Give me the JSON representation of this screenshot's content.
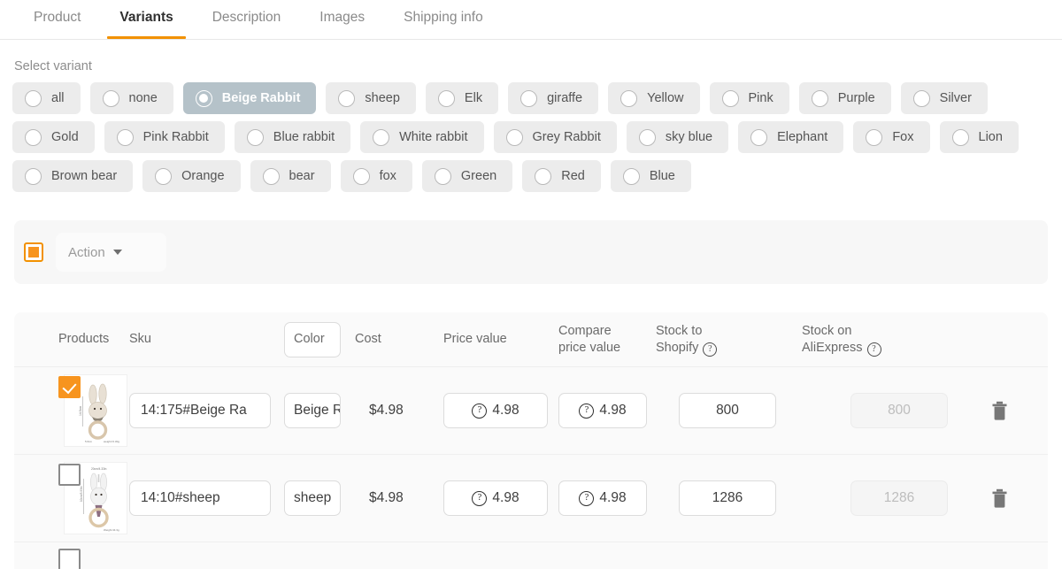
{
  "tabs": [
    {
      "label": "Product",
      "active": false
    },
    {
      "label": "Variants",
      "active": true
    },
    {
      "label": "Description",
      "active": false
    },
    {
      "label": "Images",
      "active": false
    },
    {
      "label": "Shipping info",
      "active": false
    }
  ],
  "variants": {
    "section_label": "Select variant",
    "selected": "Beige Rabbit",
    "chips": [
      {
        "label": "all",
        "selected": false
      },
      {
        "label": "none",
        "selected": false
      },
      {
        "label": "Beige Rabbit",
        "selected": true
      },
      {
        "label": "sheep",
        "selected": false
      },
      {
        "label": "Elk",
        "selected": false
      },
      {
        "label": "giraffe",
        "selected": false
      },
      {
        "label": "Yellow",
        "selected": false
      },
      {
        "label": "Pink",
        "selected": false
      },
      {
        "label": "Purple",
        "selected": false
      },
      {
        "label": "Silver",
        "selected": false
      },
      {
        "label": "Gold",
        "selected": false
      },
      {
        "label": "Pink Rabbit",
        "selected": false
      },
      {
        "label": "Blue rabbit",
        "selected": false
      },
      {
        "label": "White rabbit",
        "selected": false
      },
      {
        "label": "Grey Rabbit",
        "selected": false
      },
      {
        "label": "sky blue",
        "selected": false
      },
      {
        "label": "Elephant",
        "selected": false
      },
      {
        "label": "Fox",
        "selected": false
      },
      {
        "label": "Lion",
        "selected": false
      },
      {
        "label": "Brown bear",
        "selected": false
      },
      {
        "label": "Orange",
        "selected": false
      },
      {
        "label": "bear",
        "selected": false
      },
      {
        "label": "fox",
        "selected": false
      },
      {
        "label": "Green",
        "selected": false
      },
      {
        "label": "Red",
        "selected": false
      },
      {
        "label": "Blue",
        "selected": false
      }
    ]
  },
  "action_bar": {
    "checkbox_state": "indeterminate",
    "select_label": "Action",
    "caret_icon": "chevron-down-icon"
  },
  "table": {
    "headers": {
      "products": "Products",
      "sku": "Sku",
      "color": "Color",
      "cost": "Cost",
      "price_value": "Price value",
      "compare_line1": "Compare",
      "compare_line2": "price value",
      "stock_shopify_line1": "Stock to",
      "stock_shopify_line2": "Shopify",
      "stock_ali_line1": "Stock on",
      "stock_ali_line2": "AliExpress",
      "help_icon": "help-circle-icon"
    },
    "rows": [
      {
        "checked": true,
        "thumb_alt": "beige-rabbit-crochet-rattle",
        "sku": "14:175#Beige Ra",
        "color": "Beige R",
        "cost": "$4.98",
        "price_value": "4.98",
        "compare_price_value": "4.98",
        "stock_shopify": "800",
        "stock_aliexpress": "800",
        "delete_icon": "trash-icon"
      },
      {
        "checked": false,
        "thumb_alt": "sheep-crochet-rattle",
        "sku": "14:10#sheep",
        "color": "sheep",
        "cost": "$4.98",
        "price_value": "4.98",
        "compare_price_value": "4.98",
        "stock_shopify": "1286",
        "stock_aliexpress": "1286",
        "delete_icon": "trash-icon"
      }
    ]
  },
  "colors": {
    "accent_orange": "#f7941e",
    "tab_underline": "#f29100",
    "chip_bg": "#ececec",
    "chip_selected_bg": "#b5c2c9",
    "panel_bg": "#fafafa"
  }
}
